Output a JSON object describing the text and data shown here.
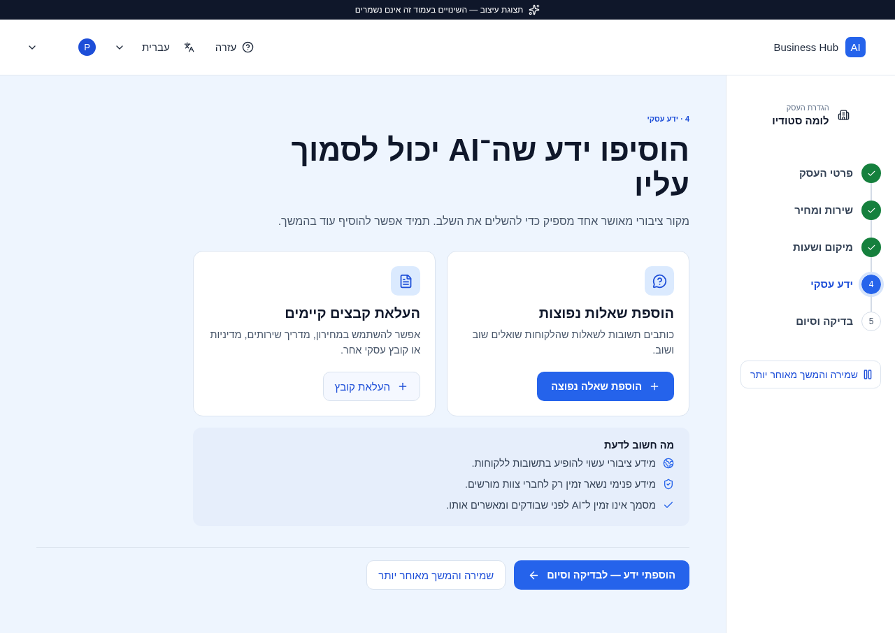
{
  "banner": {
    "text": "תצוגת עיצוב — השינויים בעמוד זה אינם נשמרים"
  },
  "header": {
    "brand": {
      "logo": "AI",
      "name": "Business Hub"
    },
    "help": {
      "label": "עזרה"
    },
    "language": {
      "label": "עברית"
    },
    "account": {
      "initial": "P"
    }
  },
  "sidebar": {
    "business": {
      "caption": "הגדרת העסק",
      "name": "לומה סטודיו"
    },
    "steps": [
      {
        "label": "פרטי העסק",
        "completed": true,
        "selected": false
      },
      {
        "label": "שירות ומחיר",
        "completed": true,
        "selected": false
      },
      {
        "label": "מיקום ושעות",
        "completed": true,
        "selected": false
      },
      {
        "number": "4",
        "label": "ידע עסקי",
        "completed": false,
        "selected": true
      },
      {
        "number": "5",
        "label": "בדיקה וסיום",
        "completed": false,
        "selected": false
      }
    ],
    "save_button": "שמירה והמשך מאוחר יותר"
  },
  "main": {
    "step_label": "4 · ידע עסקי",
    "title": "הוסיפו ידע שה־AI יכול לסמוך עליו",
    "subtitle": "מקור ציבורי מאושר אחד מספיק כדי להשלים את השלב. תמיד אפשר להוסיף עוד בהמשך.",
    "cards": [
      {
        "kind": "faq",
        "title": "הוספת שאלות נפוצות",
        "description": "כותבים תשובות לשאלות שהלקוחות שואלים שוב ושוב.",
        "button": {
          "label": "הוספת שאלה נפוצה",
          "kind": "primary"
        }
      },
      {
        "kind": "upload",
        "title": "העלאת קבצים קיימים",
        "description": "אפשר להשתמש במחירון, מדריך שירותים, מדיניות או קובץ עסקי אחר.",
        "button": {
          "label": "העלאת קובץ",
          "kind": "secondary"
        }
      }
    ],
    "info": {
      "title": "מה חשוב לדעת",
      "items": [
        {
          "kind": "public",
          "text": "מידע ציבורי עשוי להופיע בתשובות ללקוחות."
        },
        {
          "kind": "internal",
          "text": "מידע פנימי נשאר זמין רק לחברי צוות מורשים."
        },
        {
          "kind": "approval",
          "text": "מסמך אינו זמין ל־AI לפני שבודקים ומאשרים אותו."
        }
      ]
    },
    "actions": [
      {
        "label": "הוספתי ידע — לבדיקה וסיום",
        "kind": "primary"
      },
      {
        "label": "שמירה והמשך מאוחר יותר",
        "kind": "secondary"
      }
    ]
  }
}
